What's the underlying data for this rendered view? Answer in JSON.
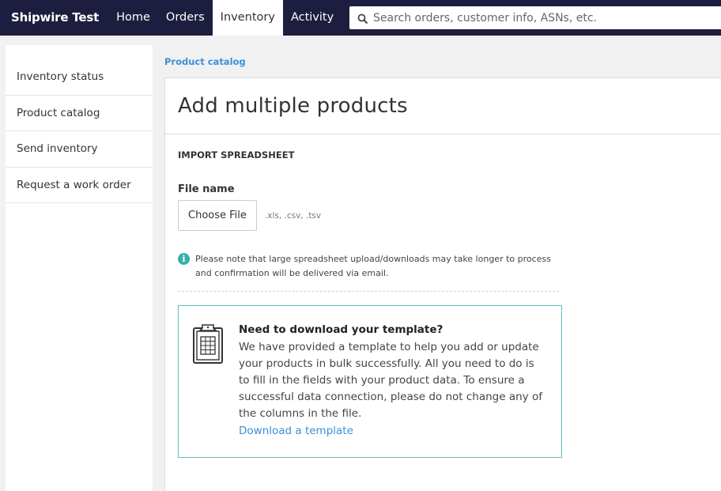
{
  "topnav": {
    "brand": "Shipwire Test",
    "items": [
      {
        "label": "Home"
      },
      {
        "label": "Orders"
      },
      {
        "label": "Inventory"
      },
      {
        "label": "Activity"
      }
    ],
    "active": "Inventory",
    "search_placeholder": "Search orders, customer info, ASNs, etc."
  },
  "sidebar": {
    "items": [
      {
        "label": "Inventory status"
      },
      {
        "label": "Product catalog"
      },
      {
        "label": "Send inventory"
      },
      {
        "label": "Request a work order"
      }
    ]
  },
  "breadcrumb": "Product catalog",
  "page_title": "Add multiple products",
  "import": {
    "heading": "IMPORT SPREADSHEET",
    "field_label": "File name",
    "choose_file_label": "Choose File",
    "file_types_hint": ".xls, .csv, .tsv",
    "note": "Please note that large spreadsheet upload/downloads may take longer to process and confirmation will be delivered via email."
  },
  "template": {
    "title": "Need to download your template?",
    "body": "We have provided a template to help you add or update your products in bulk successfully. All you need to do is to fill in the fields with your product data. To ensure a successful data connection, please do not change any of the columns in the file.",
    "link": "Download a template"
  },
  "colors": {
    "nav_bg": "#1d1e3f",
    "link": "#3a8fd8",
    "teal_accent": "#5bc3bd",
    "info_icon": "#34b1a8"
  }
}
